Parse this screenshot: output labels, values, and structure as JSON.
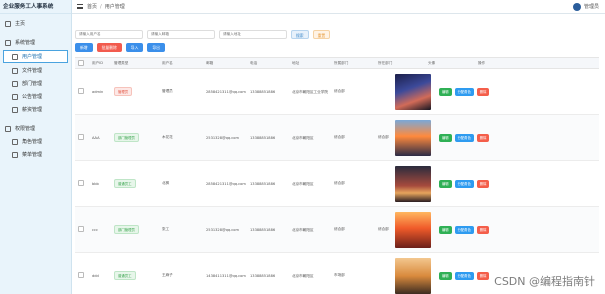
{
  "app": {
    "title": "企业服务工人事系统"
  },
  "topbar": {
    "crumb_home": "首页",
    "crumb_current": "用户管理",
    "user_name": "管理员"
  },
  "sidebar": {
    "items": [
      {
        "label": "主页"
      },
      {
        "label": "系统管理"
      },
      {
        "label": "用户管理"
      },
      {
        "label": "文件管理"
      },
      {
        "label": "部门管理"
      },
      {
        "label": "公告管理"
      },
      {
        "label": "薪资管理"
      },
      {
        "label": "权限管理"
      },
      {
        "label": "角色管理"
      },
      {
        "label": "菜单管理"
      }
    ]
  },
  "filters": {
    "username_placeholder": "请输入用户名",
    "email_placeholder": "请输入邮箱",
    "address_placeholder": "请输入地址",
    "search_label": "搜索",
    "reset_label": "重置"
  },
  "actions": {
    "add_label": "新增",
    "batch_delete_label": "批量删除",
    "import_label": "导入",
    "export_label": "导出"
  },
  "table": {
    "headers": [
      "",
      "用户ID",
      "管理类型",
      "用户名",
      "邮箱",
      "电话",
      "地址",
      "所属部门",
      "所在部门",
      "头像",
      "",
      "操作"
    ],
    "rows": [
      {
        "id": "admin",
        "role": "管理员",
        "role_color": "red",
        "name": "管理员",
        "email": "2858421311@qq.com",
        "phone": "13388851886",
        "address": "北京市朝阳区工业学院",
        "dept": "综合部",
        "dept2": "",
        "img": "img-a"
      },
      {
        "id": "AAA",
        "role": "部门管理员",
        "role_color": "green",
        "name": "木花花",
        "email": "2531328@qq.com",
        "phone": "13388851886",
        "address": "北京市朝阳区",
        "dept": "综合部",
        "dept2": "综合部",
        "img": "img-b"
      },
      {
        "id": "bbb",
        "role": "普通员工",
        "role_color": "green",
        "name": "北枫",
        "email": "2858421311@qq.com",
        "phone": "13388851886",
        "address": "北京市朝阳区",
        "dept": "综合部",
        "dept2": "",
        "img": "img-c"
      },
      {
        "id": "ccc",
        "role": "部门管理员",
        "role_color": "green",
        "name": "张工",
        "email": "2531328@qq.com",
        "phone": "13388851886",
        "address": "北京市朝阳区",
        "dept": "综合部",
        "dept2": "综合部",
        "img": "img-d"
      },
      {
        "id": "ddd",
        "role": "普通员工",
        "role_color": "green",
        "name": "王麻子",
        "email": "1438411311@qq.com",
        "phone": "13388851886",
        "address": "北京市朝阳区",
        "dept": "市场部",
        "dept2": "",
        "img": "img-e"
      }
    ],
    "ops": {
      "edit_label": "编辑",
      "assign_label": "分配角色",
      "delete_label": "删除"
    }
  },
  "watermark": "CSDN @编程指南针"
}
